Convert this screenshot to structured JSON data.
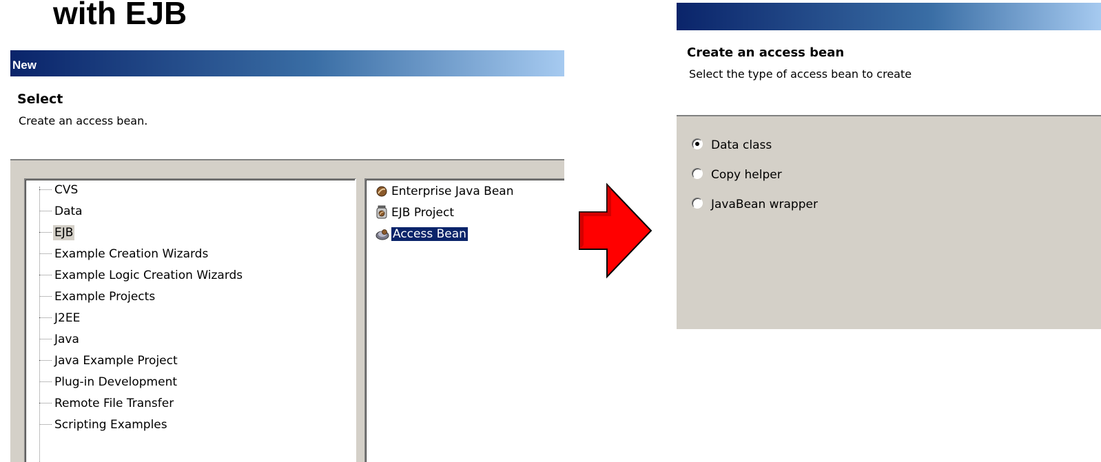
{
  "slide": {
    "title": "with EJB"
  },
  "new_dialog": {
    "window_title": "New",
    "banner_title": "Select",
    "banner_description": "Create an access bean.",
    "categories": [
      {
        "label": "CVS",
        "selected": false
      },
      {
        "label": "Data",
        "selected": false
      },
      {
        "label": "EJB",
        "selected": true
      },
      {
        "label": "Example Creation Wizards",
        "selected": false
      },
      {
        "label": "Example Logic Creation Wizards",
        "selected": false
      },
      {
        "label": "Example Projects",
        "selected": false
      },
      {
        "label": "J2EE",
        "selected": false
      },
      {
        "label": "Java",
        "selected": false
      },
      {
        "label": "Java Example Project",
        "selected": false
      },
      {
        "label": "Plug-in Development",
        "selected": false
      },
      {
        "label": "Remote File Transfer",
        "selected": false
      },
      {
        "label": "Scripting Examples",
        "selected": false
      }
    ],
    "wizards": [
      {
        "label": "Enterprise Java Bean",
        "icon": "enterprise-bean-icon",
        "selected": false
      },
      {
        "label": "EJB Project",
        "icon": "ejb-project-jar-icon",
        "selected": false
      },
      {
        "label": "Access Bean",
        "icon": "access-bean-icon",
        "selected": true
      }
    ]
  },
  "access_bean_panel": {
    "banner_title": "Create an access bean",
    "banner_description": "Select the type of access bean to create",
    "options": [
      {
        "label": "Data class",
        "checked": true
      },
      {
        "label": "Copy helper",
        "checked": false
      },
      {
        "label": "JavaBean wrapper",
        "checked": false
      }
    ]
  },
  "colors": {
    "titlebar_start": "#0a246a",
    "titlebar_end": "#a6caf0",
    "dialog_face": "#d4d0c8",
    "selection": "#0a246a",
    "arrow_fill": "#ff0000"
  },
  "icons": {
    "transition_arrow": "red-right-arrow-icon"
  }
}
